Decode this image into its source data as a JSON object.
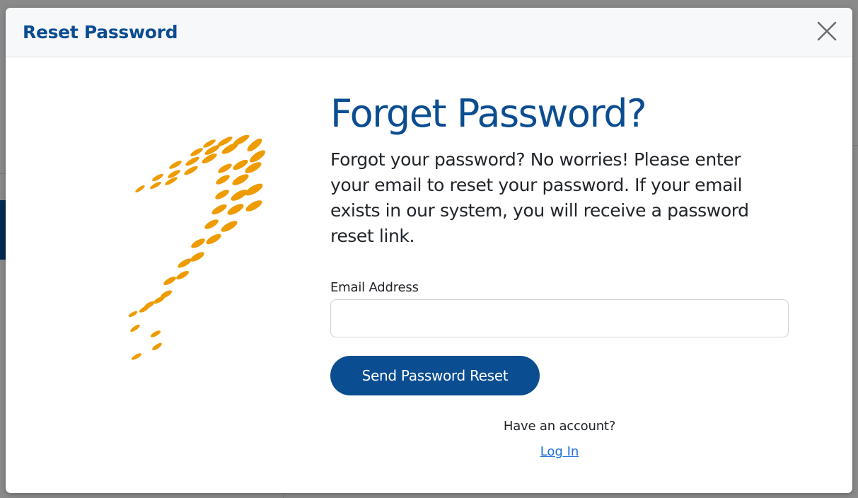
{
  "modal": {
    "title": "Reset Password",
    "close_icon": "close-icon"
  },
  "logo": {
    "icon": "brand-swoosh-logo",
    "color": "#ee9b00"
  },
  "form": {
    "heading": "Forget Password?",
    "description": "Forgot your password? No worries! Please enter your email to reset your password. If your email exists in our system, you will receive a password reset link.",
    "email_label": "Email Address",
    "email_value": "",
    "email_placeholder": "",
    "submit_label": "Send Password Reset",
    "have_account_text": "Have an account?",
    "login_link_text": "Log In"
  },
  "colors": {
    "brand_blue": "#0b4d91",
    "link_blue": "#1e6fd9",
    "logo_orange": "#ee9b00"
  }
}
